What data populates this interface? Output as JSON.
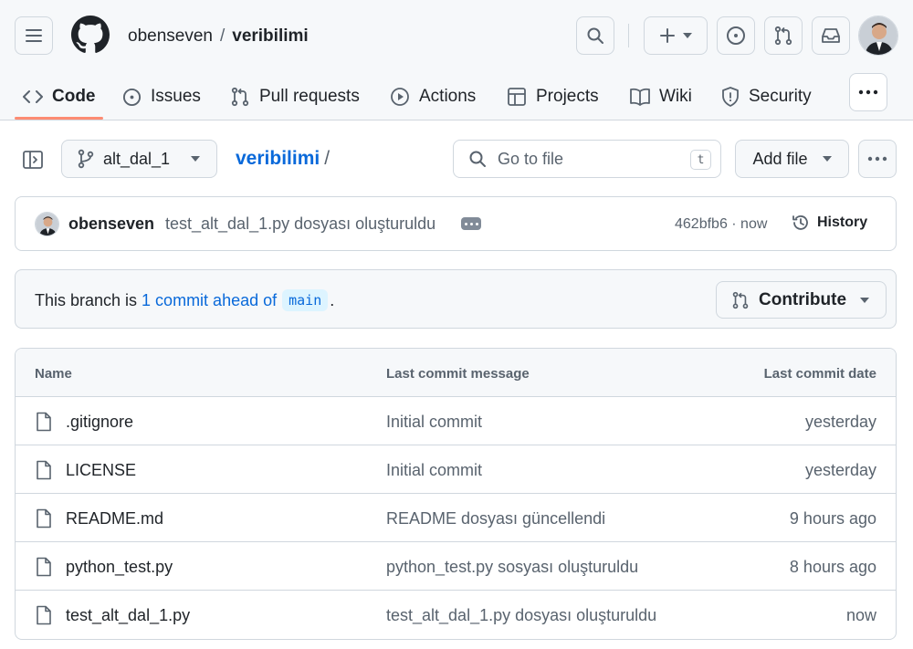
{
  "header": {
    "owner": "obenseven",
    "separator": "/",
    "repo": "veribilimi"
  },
  "tabs": [
    {
      "label": "Code",
      "icon": "code-icon"
    },
    {
      "label": "Issues",
      "icon": "issue-opened-icon"
    },
    {
      "label": "Pull requests",
      "icon": "git-pull-request-icon"
    },
    {
      "label": "Actions",
      "icon": "play-icon"
    },
    {
      "label": "Projects",
      "icon": "table-icon"
    },
    {
      "label": "Wiki",
      "icon": "book-icon"
    },
    {
      "label": "Security",
      "icon": "shield-icon"
    }
  ],
  "toolbar": {
    "branch": "alt_dal_1",
    "breadcrumb_repo": "veribilimi",
    "breadcrumb_sep": "/",
    "goto_placeholder": "Go to file",
    "goto_shortcut": "t",
    "add_file": "Add file"
  },
  "latest_commit": {
    "author": "obenseven",
    "message": "test_alt_dal_1.py dosyası oluşturuldu",
    "sha_time": "462bfb6 · now",
    "history": "History"
  },
  "ahead": {
    "prefix": "This branch is",
    "link": "1 commit ahead of",
    "base": "main",
    "suffix": ".",
    "contribute": "Contribute"
  },
  "files_table": {
    "headers": [
      "Name",
      "Last commit message",
      "Last commit date"
    ],
    "rows": [
      {
        "name": ".gitignore",
        "message": "Initial commit",
        "date": "yesterday"
      },
      {
        "name": "LICENSE",
        "message": "Initial commit",
        "date": "yesterday"
      },
      {
        "name": "README.md",
        "message": "README dosyası güncellendi",
        "date": "9 hours ago"
      },
      {
        "name": "python_test.py",
        "message": "python_test.py sosyası oluşturuldu",
        "date": "8 hours ago"
      },
      {
        "name": "test_alt_dal_1.py",
        "message": "test_alt_dal_1.py dosyası oluşturuldu",
        "date": "now"
      }
    ]
  },
  "colors": {
    "accent_link": "#0969da",
    "tab_underline": "#fd8c73",
    "header_bg": "#f6f8fa",
    "border": "#d0d7de"
  }
}
